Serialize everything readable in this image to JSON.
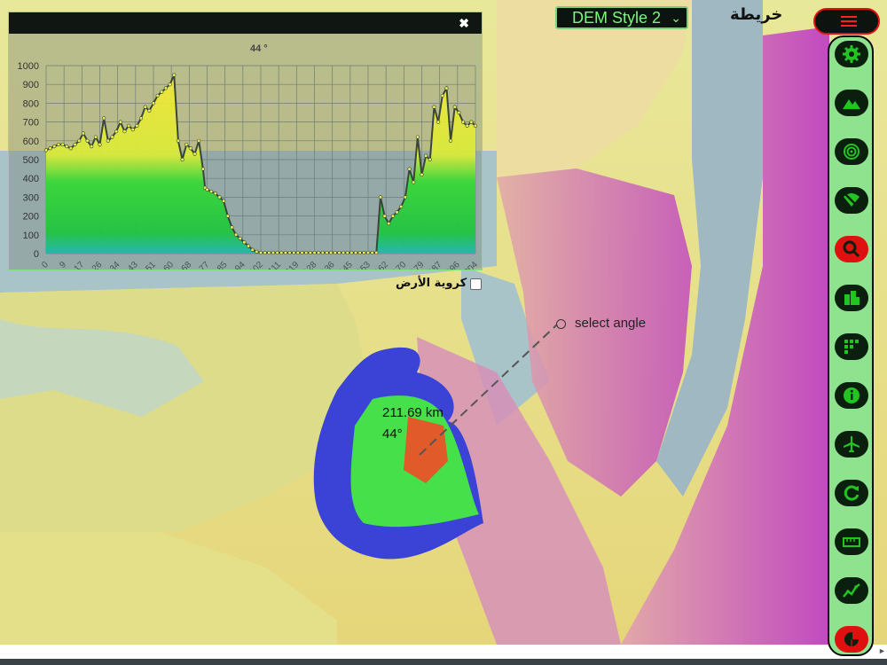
{
  "map": {
    "title": "خريطة",
    "dem_style": {
      "selected": "DEM Style 2"
    },
    "earth_curvature_label": "كروية الأرض",
    "select_angle_label": "select angle",
    "distance_label": "211.69 km",
    "angle_label": "44°",
    "colors": {
      "coverage_blue": "#3b43d6",
      "coverage_green": "#46e04a",
      "coverage_orange": "#e05a2a"
    }
  },
  "chart_panel": {
    "close_icon": "close-icon",
    "chart_data": {
      "type": "area",
      "title": "44 °",
      "ylim": [
        0,
        1000
      ],
      "y_ticks": [
        0,
        100,
        200,
        300,
        400,
        500,
        600,
        700,
        800,
        900,
        1000
      ],
      "x_ticks": [
        "0",
        "9",
        "17",
        "26",
        "34",
        "43",
        "51",
        "60",
        "68",
        "77",
        "85",
        "94",
        "102",
        "111",
        "119",
        "128",
        "136",
        "145",
        "153",
        "162",
        "170",
        "179",
        "187",
        "196",
        "204"
      ],
      "x": [
        0,
        2,
        4,
        6,
        8,
        10,
        12,
        14,
        16,
        18,
        20,
        22,
        24,
        26,
        28,
        30,
        32,
        34,
        36,
        38,
        40,
        42,
        44,
        46,
        48,
        50,
        52,
        54,
        56,
        58,
        60,
        62,
        64,
        66,
        68,
        70,
        72,
        74,
        76,
        77,
        78,
        80,
        82,
        84,
        86,
        88,
        90,
        92,
        94,
        96,
        98,
        100,
        102,
        104,
        106,
        108,
        110,
        112,
        114,
        116,
        118,
        120,
        122,
        124,
        126,
        128,
        130,
        132,
        134,
        136,
        138,
        140,
        142,
        144,
        146,
        148,
        150,
        152,
        154,
        156,
        158,
        160,
        162,
        164,
        166,
        168,
        170,
        172,
        174,
        176,
        178,
        180,
        182,
        184,
        186,
        188,
        190,
        192,
        194,
        196,
        198,
        200,
        202,
        204,
        206,
        208
      ],
      "values": [
        550,
        560,
        570,
        580,
        580,
        570,
        560,
        580,
        600,
        640,
        600,
        570,
        620,
        580,
        720,
        600,
        620,
        650,
        700,
        650,
        680,
        660,
        680,
        720,
        780,
        760,
        800,
        840,
        860,
        880,
        900,
        950,
        600,
        500,
        580,
        560,
        530,
        600,
        450,
        350,
        340,
        330,
        320,
        300,
        280,
        200,
        140,
        100,
        80,
        60,
        40,
        20,
        10,
        5,
        5,
        5,
        5,
        5,
        5,
        5,
        5,
        5,
        5,
        5,
        5,
        5,
        5,
        5,
        5,
        5,
        5,
        5,
        5,
        5,
        5,
        5,
        5,
        5,
        5,
        5,
        5,
        5,
        300,
        200,
        160,
        200,
        220,
        250,
        300,
        450,
        380,
        620,
        420,
        520,
        500,
        780,
        700,
        840,
        880,
        600,
        780,
        750,
        700,
        680,
        700,
        680
      ],
      "series": [
        {
          "values_ref": "values",
          "color": "#2a3d2a"
        }
      ]
    }
  },
  "toolbar": {
    "menu_icon": "hamburger-menu-icon",
    "tools": [
      {
        "name": "settings-icon"
      },
      {
        "name": "terrain-icon"
      },
      {
        "name": "target-rings-icon"
      },
      {
        "name": "no-signal-icon"
      },
      {
        "name": "search-map-icon"
      },
      {
        "name": "buildings-icon"
      },
      {
        "name": "grid-icon"
      },
      {
        "name": "info-icon"
      },
      {
        "name": "airplane-icon"
      },
      {
        "name": "refresh-icon"
      },
      {
        "name": "ruler-icon"
      },
      {
        "name": "line-chart-icon"
      },
      {
        "name": "pie-chart-icon"
      }
    ]
  }
}
